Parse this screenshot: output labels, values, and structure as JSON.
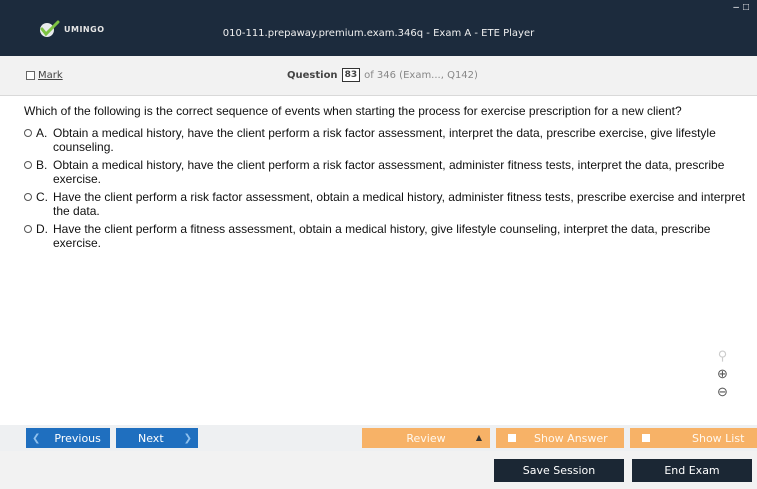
{
  "app": {
    "logo_text": "UMINGO",
    "window_title": "010-111.prepaway.premium.exam.346q - Exam A - ETE Player",
    "controls": {
      "minimize": "–",
      "maximize": "□"
    }
  },
  "question_bar": {
    "mark_label": "Mark",
    "question_label": "Question",
    "question_number": "83",
    "question_rest": "of 346 (Exam..., Q142)"
  },
  "question": {
    "text": "Which of the following is the correct sequence of events when starting the process for exercise prescription for a new client?",
    "options": [
      {
        "letter": "A.",
        "text": "Obtain a medical history, have the client perform a risk factor assessment, interpret the data, prescribe exercise, give lifestyle counseling."
      },
      {
        "letter": "B.",
        "text": "Obtain a medical history, have the client perform a risk factor assessment, administer fitness tests, interpret the data, prescribe exercise."
      },
      {
        "letter": "C.",
        "text": "Have the client perform a risk factor assessment, obtain a medical history, administer fitness tests, prescribe exercise and interpret the data."
      },
      {
        "letter": "D.",
        "text": "Have the client perform a fitness assessment, obtain a medical history, give lifestyle counseling, interpret the data, prescribe exercise."
      }
    ]
  },
  "zoom": {
    "search_icon": "⚲",
    "zoom_in_icon": "⊕",
    "zoom_out_icon": "⊖"
  },
  "nav": {
    "previous": "Previous",
    "previous_arrow": "❮",
    "next": "Next",
    "next_arrow": "❯",
    "review": "Review",
    "review_caret": "▲",
    "show_answer": "Show Answer",
    "show_list": "Show List"
  },
  "footer": {
    "save_session": "Save Session",
    "end_exam": "End Exam"
  },
  "colors": {
    "titlebar": "#1c2b3d",
    "nav_blue": "#1f6fbf",
    "orange": "#f7b267",
    "dark_button": "#1b2734",
    "logo_green": "#7dc242"
  }
}
